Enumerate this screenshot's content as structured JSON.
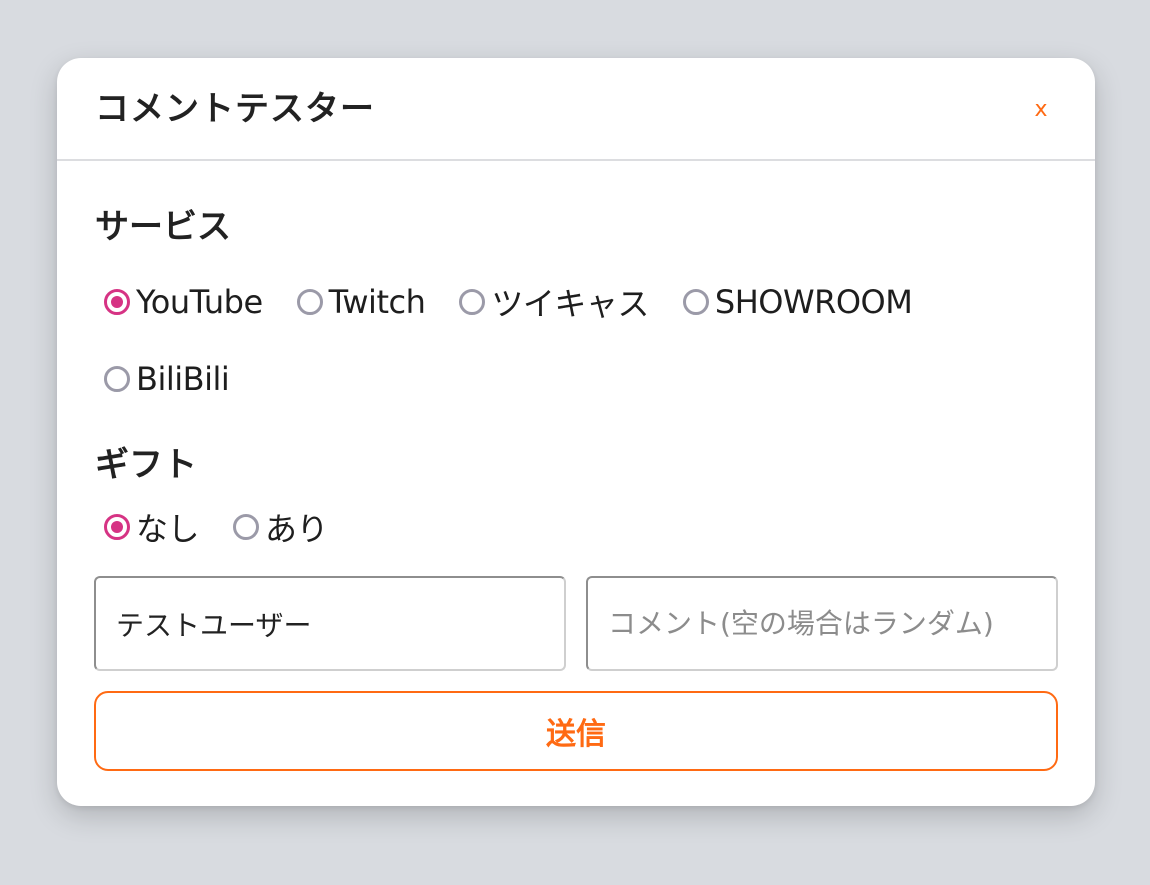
{
  "dialog": {
    "title": "コメントテスター",
    "close_label": "x"
  },
  "service": {
    "label": "サービス",
    "options": [
      {
        "label": "YouTube",
        "selected": true
      },
      {
        "label": "Twitch",
        "selected": false
      },
      {
        "label": "ツイキャス",
        "selected": false
      },
      {
        "label": "SHOWROOM",
        "selected": false
      },
      {
        "label": "BiliBili",
        "selected": false
      }
    ]
  },
  "gift": {
    "label": "ギフト",
    "options": [
      {
        "label": "なし",
        "selected": true
      },
      {
        "label": "あり",
        "selected": false
      }
    ]
  },
  "form": {
    "username_value": "テストユーザー",
    "username_placeholder": "",
    "comment_value": "",
    "comment_placeholder": "コメント(空の場合はランダム)",
    "submit_label": "送信"
  },
  "colors": {
    "accent": "#ff6a13",
    "radio_checked": "#d63384",
    "radio_unchecked": "#9b9aa8",
    "background": "#d8dbe0"
  }
}
